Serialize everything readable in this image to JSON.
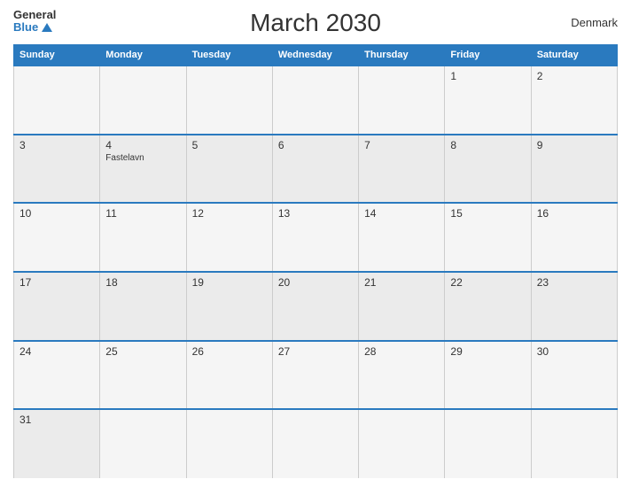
{
  "logo": {
    "general": "General",
    "blue": "Blue"
  },
  "title": "March 2030",
  "country": "Denmark",
  "weekdays": [
    "Sunday",
    "Monday",
    "Tuesday",
    "Wednesday",
    "Thursday",
    "Friday",
    "Saturday"
  ],
  "weeks": [
    [
      {
        "day": "",
        "holiday": ""
      },
      {
        "day": "",
        "holiday": ""
      },
      {
        "day": "",
        "holiday": ""
      },
      {
        "day": "",
        "holiday": ""
      },
      {
        "day": "",
        "holiday": ""
      },
      {
        "day": "1",
        "holiday": ""
      },
      {
        "day": "2",
        "holiday": ""
      }
    ],
    [
      {
        "day": "3",
        "holiday": ""
      },
      {
        "day": "4",
        "holiday": "Fastelavn"
      },
      {
        "day": "5",
        "holiday": ""
      },
      {
        "day": "6",
        "holiday": ""
      },
      {
        "day": "7",
        "holiday": ""
      },
      {
        "day": "8",
        "holiday": ""
      },
      {
        "day": "9",
        "holiday": ""
      }
    ],
    [
      {
        "day": "10",
        "holiday": ""
      },
      {
        "day": "11",
        "holiday": ""
      },
      {
        "day": "12",
        "holiday": ""
      },
      {
        "day": "13",
        "holiday": ""
      },
      {
        "day": "14",
        "holiday": ""
      },
      {
        "day": "15",
        "holiday": ""
      },
      {
        "day": "16",
        "holiday": ""
      }
    ],
    [
      {
        "day": "17",
        "holiday": ""
      },
      {
        "day": "18",
        "holiday": ""
      },
      {
        "day": "19",
        "holiday": ""
      },
      {
        "day": "20",
        "holiday": ""
      },
      {
        "day": "21",
        "holiday": ""
      },
      {
        "day": "22",
        "holiday": ""
      },
      {
        "day": "23",
        "holiday": ""
      }
    ],
    [
      {
        "day": "24",
        "holiday": ""
      },
      {
        "day": "25",
        "holiday": ""
      },
      {
        "day": "26",
        "holiday": ""
      },
      {
        "day": "27",
        "holiday": ""
      },
      {
        "day": "28",
        "holiday": ""
      },
      {
        "day": "29",
        "holiday": ""
      },
      {
        "day": "30",
        "holiday": ""
      }
    ],
    [
      {
        "day": "31",
        "holiday": ""
      },
      {
        "day": "",
        "holiday": ""
      },
      {
        "day": "",
        "holiday": ""
      },
      {
        "day": "",
        "holiday": ""
      },
      {
        "day": "",
        "holiday": ""
      },
      {
        "day": "",
        "holiday": ""
      },
      {
        "day": "",
        "holiday": ""
      }
    ]
  ]
}
